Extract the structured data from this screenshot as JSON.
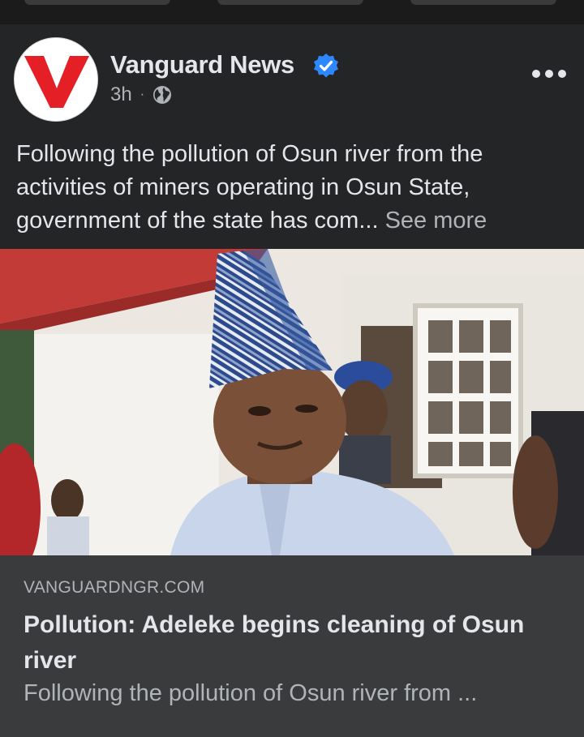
{
  "post": {
    "page_name": "Vanguard News",
    "time": "3h",
    "separator": "·",
    "audience_icon": "globe-icon",
    "verified_icon": "verified-badge-icon",
    "more_icon": "more-options-icon",
    "text": "Following the pollution of Osun river from the activities of miners operating in Osun State, government of the state has com...",
    "see_more": "See more"
  },
  "link_preview": {
    "domain": "VANGUARDNGR.COM",
    "title": "Pollution: Adeleke begins cleaning of Osun river",
    "description": "Following the pollution of Osun river from ..."
  },
  "colors": {
    "background": "#242526",
    "link_box": "#3a3b3c",
    "verified": "#2d88ff",
    "logo_red": "#e41f26",
    "text_primary": "#e4e6eb",
    "text_secondary": "#b0b3b8"
  }
}
